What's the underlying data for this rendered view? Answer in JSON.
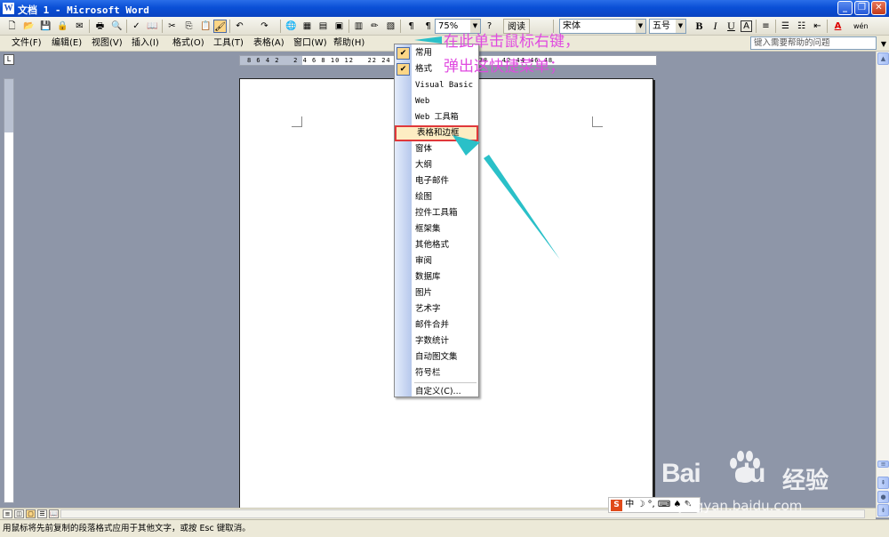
{
  "window": {
    "title": "文档 1 - Microsoft Word",
    "app_icon": "W"
  },
  "toolbar": {
    "zoom": "75%",
    "read_label": "阅读",
    "font_name": "宋体",
    "font_size": "五号",
    "bold": "B",
    "italic": "I",
    "underline": "U",
    "char_border": "A"
  },
  "menubar": {
    "items": [
      "文件(F)",
      "编辑(E)",
      "视图(V)",
      "插入(I)",
      "格式(O)",
      "工具(T)",
      "表格(A)",
      "窗口(W)",
      "帮助(H)"
    ],
    "help_placeholder": "键入需要帮助的问题"
  },
  "ruler": {
    "numbers": "8 6 4 2   2 4 6 8 10 12   22 24 26 28 30 32 34 36 38   42 44 46 48"
  },
  "context_menu": {
    "items": [
      {
        "label": "常用",
        "checked": true
      },
      {
        "label": "格式",
        "checked": true
      },
      {
        "label": "Visual Basic",
        "checked": false
      },
      {
        "label": "Web",
        "checked": false
      },
      {
        "label": "Web 工具箱",
        "checked": false
      },
      {
        "label": "表格和边框",
        "checked": false,
        "highlighted": true
      },
      {
        "label": "窗体",
        "checked": false
      },
      {
        "label": "大纲",
        "checked": false
      },
      {
        "label": "电子邮件",
        "checked": false
      },
      {
        "label": "绘图",
        "checked": false
      },
      {
        "label": "控件工具箱",
        "checked": false
      },
      {
        "label": "框架集",
        "checked": false
      },
      {
        "label": "其他格式",
        "checked": false
      },
      {
        "label": "审阅",
        "checked": false
      },
      {
        "label": "数据库",
        "checked": false
      },
      {
        "label": "图片",
        "checked": false
      },
      {
        "label": "艺术字",
        "checked": false
      },
      {
        "label": "邮件合并",
        "checked": false
      },
      {
        "label": "字数统计",
        "checked": false
      },
      {
        "label": "自动图文集",
        "checked": false
      },
      {
        "label": "符号栏",
        "checked": false
      },
      {
        "label": "自定义(C)...",
        "checked": false
      }
    ]
  },
  "annotation": {
    "line1": "在此单击鼠标右键，",
    "line2": "弹出这快捷菜单；",
    "color": "#e04ae0"
  },
  "status": {
    "text": "用鼠标将先前复制的段落格式应用于其他文字，或按 Esc 键取消。"
  },
  "ime": {
    "text": "中 ☽ °, ⌨ ♠ ✎"
  },
  "watermark": {
    "brand": "Bai",
    "brand2": "du",
    "cn": "经验",
    "url": "jingyan.baidu.com"
  }
}
